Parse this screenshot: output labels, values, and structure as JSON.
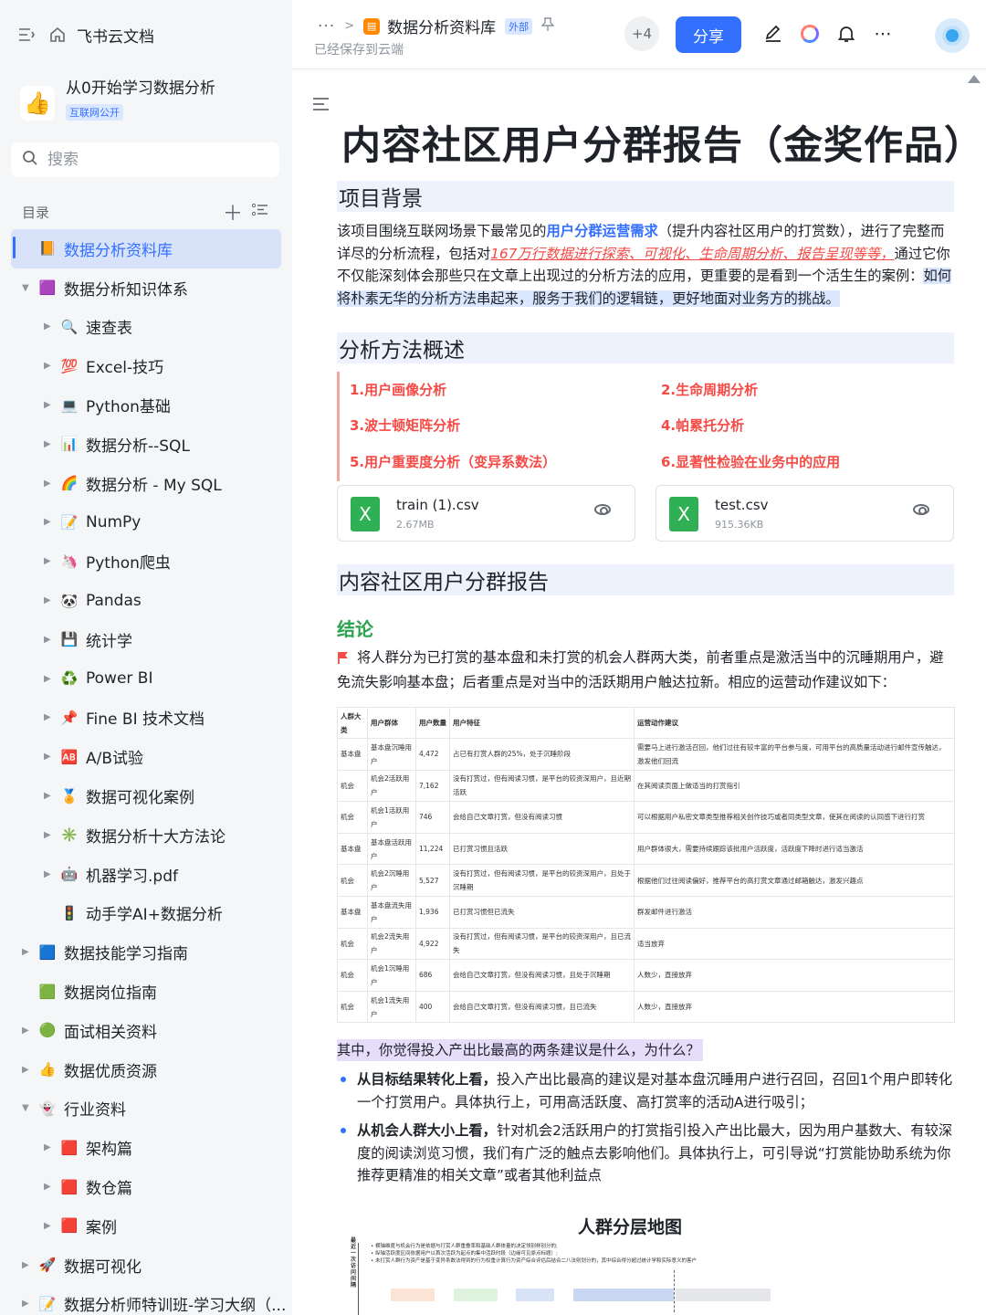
{
  "sidebar": {
    "brand": "飞书云文档",
    "space_name": "从0开始学习数据分析",
    "space_badge": "互联网公开",
    "search_placeholder": "搜索",
    "toc_label": "目录",
    "items": [
      {
        "label": "数据分析资料库",
        "icon": "📙",
        "active": true
      },
      {
        "label": "数据分析知识体系",
        "icon": "🟪",
        "expanded": true
      },
      {
        "label": "速查表",
        "icon": "🔍"
      },
      {
        "label": "Excel-技巧",
        "icon": "💯"
      },
      {
        "label": "Python基础",
        "icon": "💻"
      },
      {
        "label": "数据分析--SQL",
        "icon": "📊"
      },
      {
        "label": "数据分析 - My SQL",
        "icon": "🌈"
      },
      {
        "label": "NumPy",
        "icon": "📝"
      },
      {
        "label": "Python爬虫",
        "icon": "🦄"
      },
      {
        "label": "Pandas",
        "icon": "🐼"
      },
      {
        "label": "统计学",
        "icon": "💾"
      },
      {
        "label": "Power BI",
        "icon": "♻️"
      },
      {
        "label": "Fine BI 技术文档",
        "icon": "📌"
      },
      {
        "label": "A/B试验",
        "icon": "🆎"
      },
      {
        "label": "数据可视化案例",
        "icon": "🏅"
      },
      {
        "label": "数据分析十大方法论",
        "icon": "✳️"
      },
      {
        "label": "机器学习.pdf",
        "icon": "🤖"
      },
      {
        "label": "动手学AI+数据分析",
        "icon": "🚦"
      },
      {
        "label": "数据技能学习指南",
        "icon": "🟦"
      },
      {
        "label": "数据岗位指南",
        "icon": "🟩"
      },
      {
        "label": "面试相关资料",
        "icon": "🟢"
      },
      {
        "label": "数据优质资源",
        "icon": "👍"
      },
      {
        "label": "行业资料",
        "icon": "👻",
        "expanded": true
      },
      {
        "label": "架构篇",
        "icon": "🟥"
      },
      {
        "label": "数仓篇",
        "icon": "🟥"
      },
      {
        "label": "案例",
        "icon": "🟥"
      },
      {
        "label": "数据可视化",
        "icon": "🚀"
      },
      {
        "label": "数据分析师特训班-学习大纲（...",
        "icon": "📝"
      }
    ]
  },
  "topbar": {
    "doc_title": "数据分析资料库",
    "external_badge": "外部",
    "saved_status": "已经保存到云端",
    "collaborators": "+4",
    "share_label": "分享"
  },
  "doc": {
    "title": "内容社区用户分群报告（金奖作品）",
    "section_background": "项目背景",
    "bg_p1": "该项目围绕互联网场景下最常见的",
    "bg_p2": "用户分群运营需求",
    "bg_p3": "（提升内容社区用户的打赏数），进行了完整而详尽的分析流程，包括对",
    "bg_p4": "167万行数据进行探索、可视化、生命周期分析、报告呈现等等，",
    "bg_p5": "通过它你不仅能深刻体会那些只在文章上出现过的分析方法的应用，更重要的是看到一个活生生的案例：",
    "bg_p6": "如何将朴素无华的分析方法串起来，服务于我们的逻辑链，更好地面对业务方的挑战。",
    "section_methods": "分析方法概述",
    "methods": [
      "1.用户画像分析",
      "2.生命周期分析",
      "3.波士顿矩阵分析",
      "4.帕累托分析",
      "5.用户重要度分析（变异系数法）",
      "6.显著性检验在业务中的应用"
    ],
    "files": [
      {
        "name": "train (1).csv",
        "size": "2.67MB"
      },
      {
        "name": "test.csv",
        "size": "915.36KB"
      }
    ],
    "section_report": "内容社区用户分群报告",
    "conclusion_heading": "结论",
    "conclusion_text": "将人群分为已打赏的基本盘和未打赏的机会人群两大类，前者重点是激活当中的沉睡期用户，避免流失影响基本盘；后者重点是对当中的活跃期用户触达拉新。相应的运营动作建议如下：",
    "question": "其中，你觉得投入产出比最高的两条建议是什么，为什么？",
    "bullet1_bold": "从目标结果转化上看，",
    "bullet1_text": "投入产出比最高的建议是对基本盘沉睡用户进行召回，召回1个用户即转化一个打赏用户。具体执行上，可用高活跃度、高打赏率的活动A进行吸引；",
    "bullet2_bold": "从机会人群大小上看，",
    "bullet2_text": "针对机会2活跃用户的打赏指引投入产出比最大，因为用户基数大、有较深度的阅读浏览习惯，我们有广泛的触点去影响他们。具体执行上，可引导说“打赏能协助系统为你推荐更精准的相关文章”或者其他利益点",
    "map_title": "人群分层地图",
    "map_ylabel": "最近一次访问间隔",
    "map_notes": [
      "• 横轴维度与机会行为是依据与打赏人群重叠率和基础人群体量的决定领别样别分的;",
      "• 纵轴活跃度区间依据用户以首次活跃为起点的集中活跃时段（边缘可见原点标题）;",
      "• 未打赏人群行为资产是基于变异系数法得到的行为权重计算行为资产综合评估后结合二八法则划分的，其中综合得分超过统计学和实际意义的客户"
    ]
  },
  "table": {
    "headers": [
      "人群大类",
      "用户群体",
      "用户数量",
      "用户特征",
      "运营动作建议"
    ],
    "rows": [
      [
        "基本盘",
        "基本盘沉睡用户",
        "4,472",
        "占已有打赏人群的25%，处于沉睡阶段",
        "需要马上进行激活召回，他们过往有较丰富的平台参与度，可用平台的高质量活动进行邮件宣传触达，激发他们回流"
      ],
      [
        "机会",
        "机会2活跃用户",
        "7,162",
        "没有打赏过，但有阅读习惯，是平台的较资深用户，且近期活跃",
        "在其阅读页面上做适当的打赏指引"
      ],
      [
        "机会",
        "机会1活跃用户",
        "746",
        "会给自己文章打赏，但没有阅读习惯",
        "可以根据用户私密文章类型推荐相关创作技巧或者同类型文章，使其在阅读的认同感下进行打赏"
      ],
      [
        "基本盘",
        "基本盘活跃用户",
        "11,224",
        "已打赏习惯且活跃",
        "用户群体很大，需要持续跟踪该批用户活跃度，活跃度下降时进行适当激活"
      ],
      [
        "机会",
        "机会2沉睡用户",
        "5,527",
        "没有打赏过，但有阅读习惯，是平台的较资深用户，且处于沉睡期",
        "根据他们过往阅读偏好，推荐平台的高打赏文章通过邮箱触达，激发兴趣点"
      ],
      [
        "基本盘",
        "基本盘流失用户",
        "1,936",
        "已打赏习惯但已流失",
        "群发邮件进行激活"
      ],
      [
        "机会",
        "机会2流失用户",
        "4,922",
        "没有打赏过，但有阅读习惯，是平台的较资深用户，且已流失",
        "适当放弃"
      ],
      [
        "机会",
        "机会1沉睡用户",
        "686",
        "会给自己文章打赏，但没有阅读习惯，且处于沉睡期",
        "人数少，直接放弃"
      ],
      [
        "机会",
        "机会1流失用户",
        "400",
        "会给自己文章打赏，但没有阅读习惯，且已流失",
        "人数少，直接放弃"
      ]
    ]
  },
  "icons": {
    "sidebar_toggle": "sidebar-toggle-icon",
    "home": "home-icon",
    "search": "search-icon",
    "edit": "pencil-icon",
    "bell": "bell-icon",
    "more": "more-icon"
  },
  "colors": {
    "accent": "#3370ff",
    "heading_bg": "#eef2fd",
    "method_red": "#f54a45",
    "conclusion_green": "#2ba34f"
  }
}
